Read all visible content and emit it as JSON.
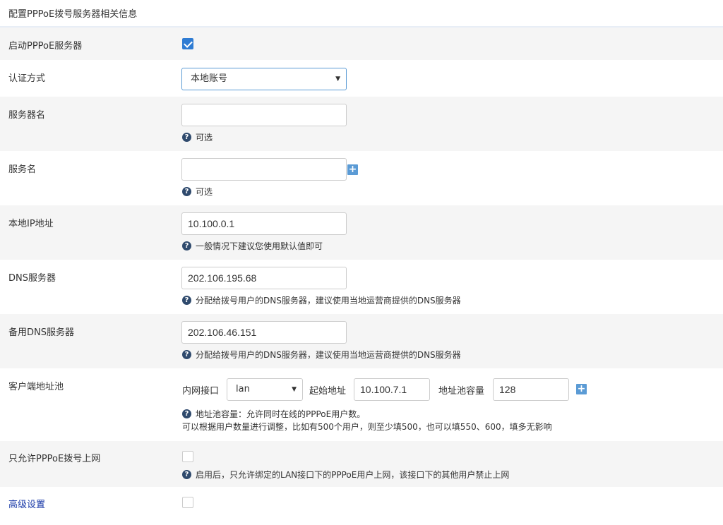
{
  "header": {
    "title": "配置PPPoE拨号服务器相关信息"
  },
  "fields": {
    "enable": {
      "label": "启动PPPoE服务器",
      "checked": true
    },
    "auth": {
      "label": "认证方式",
      "value": "本地账号"
    },
    "server_name": {
      "label": "服务器名",
      "value": "",
      "help": "可选"
    },
    "service_name": {
      "label": "服务名",
      "value": "",
      "help": "可选"
    },
    "local_ip": {
      "label": "本地IP地址",
      "value": "10.100.0.1",
      "help": "一般情况下建议您使用默认值即可"
    },
    "dns": {
      "label": "DNS服务器",
      "value": "202.106.195.68",
      "help": "分配给拨号用户的DNS服务器，建议使用当地运营商提供的DNS服务器"
    },
    "dns2": {
      "label": "备用DNS服务器",
      "value": "202.106.46.151",
      "help": "分配给拨号用户的DNS服务器，建议使用当地运营商提供的DNS服务器"
    },
    "pool": {
      "label": "客户端地址池",
      "iface_label": "内网接口",
      "iface_value": "lan",
      "start_label": "起始地址",
      "start_value": "10.100.7.1",
      "cap_label": "地址池容量",
      "cap_value": "128",
      "help1": "地址池容量：允许同时在线的PPPoE用户数。",
      "help2": "可以根据用户数量进行调整，比如有500个用户，则至少填500，也可以填550、600，填多无影响"
    },
    "only_pppoe": {
      "label": "只允许PPPoE拨号上网",
      "checked": false,
      "help": "启用后，只允许绑定的LAN接口下的PPPoE用户上网，该接口下的其他用户禁止上网"
    },
    "advanced": {
      "label": "高级设置",
      "checked": false
    }
  },
  "colors": {
    "accent": "#2f7cd3",
    "row_gray": "#f5f5f5",
    "plus": "#5b9bd5",
    "advanced_link": "#1a3aa8"
  }
}
